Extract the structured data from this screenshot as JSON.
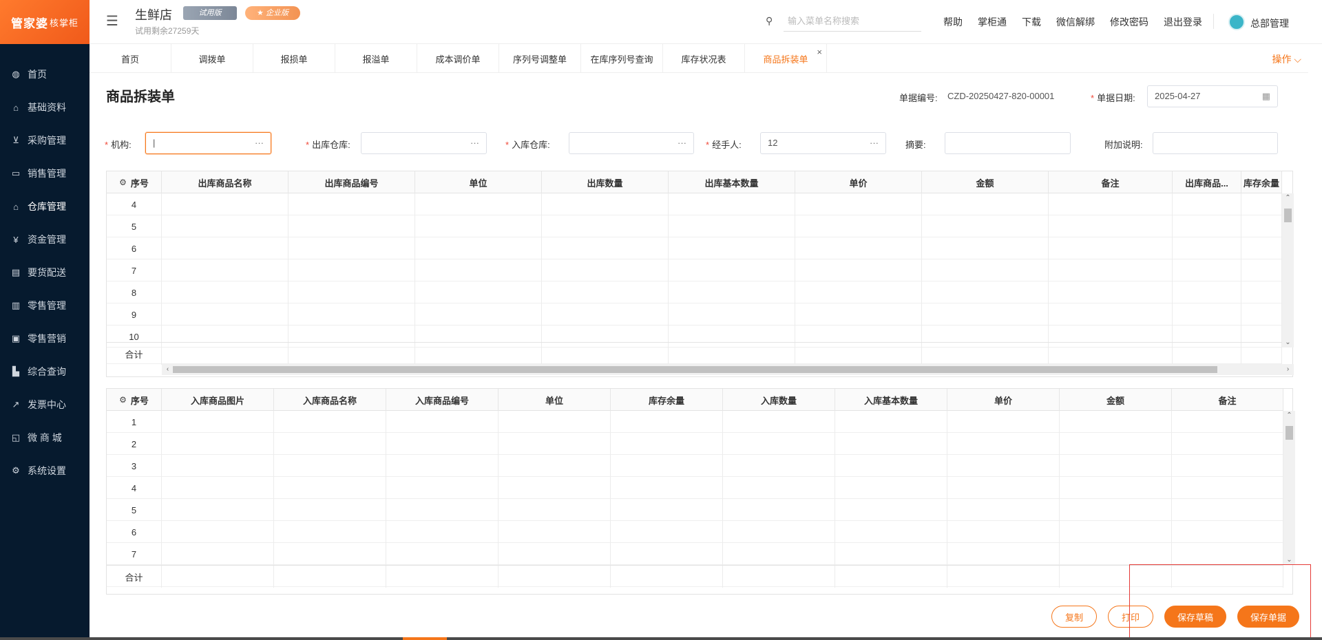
{
  "sidebar": {
    "logo": "管家婆",
    "logo_sub": "核掌柜",
    "items": [
      {
        "label": "首页",
        "icon": "globe-icon"
      },
      {
        "label": "基础资料",
        "icon": "home-icon"
      },
      {
        "label": "采购管理",
        "icon": "cart-icon"
      },
      {
        "label": "销售管理",
        "icon": "sales-icon"
      },
      {
        "label": "仓库管理",
        "icon": "warehouse-icon"
      },
      {
        "label": "资金管理",
        "icon": "fund-icon"
      },
      {
        "label": "要货配送",
        "icon": "delivery-icon"
      },
      {
        "label": "零售管理",
        "icon": "retail-icon"
      },
      {
        "label": "零售营销",
        "icon": "gift-icon"
      },
      {
        "label": "综合查询",
        "icon": "chart-icon"
      },
      {
        "label": "发票中心",
        "icon": "invoice-icon"
      },
      {
        "label": "微 商 城",
        "icon": "shop-icon"
      },
      {
        "label": "系统设置",
        "icon": "gear-icon"
      }
    ]
  },
  "header": {
    "store_name": "生鲜店",
    "badge_trial": "试用版",
    "badge_edition": "企业版",
    "trial_remaining": "试用剩余27259天",
    "search_placeholder": "输入菜单名称搜索",
    "links": [
      "帮助",
      "掌柜通",
      "下载",
      "微信解绑",
      "修改密码",
      "退出登录"
    ],
    "user": "总部管理"
  },
  "tabs": [
    {
      "label": "首页"
    },
    {
      "label": "调拨单"
    },
    {
      "label": "报损单"
    },
    {
      "label": "报溢单"
    },
    {
      "label": "成本调价单"
    },
    {
      "label": "序列号调整单"
    },
    {
      "label": "在库序列号查询"
    },
    {
      "label": "库存状况表"
    },
    {
      "label": "商品拆装单",
      "active": true
    }
  ],
  "ops_label": "操作 ⌵",
  "page": {
    "title": "商品拆装单",
    "doc_no_label": "单据编号:",
    "doc_no": "CZD-20250427-820-00001",
    "date_label": "单据日期:",
    "date": "2025-04-27"
  },
  "form": {
    "org_label": "机构:",
    "out_wh_label": "出库仓库:",
    "in_wh_label": "入库仓库:",
    "handler_label": "经手人:",
    "handler_value": "12",
    "summary_label": "摘要:",
    "note_label": "附加说明:"
  },
  "out_table": {
    "columns": [
      "序号",
      "出库商品名称",
      "出库商品编号",
      "单位",
      "出库数量",
      "出库基本数量",
      "单价",
      "金额",
      "备注",
      "出库商品...",
      "库存余量"
    ],
    "rows": [
      "4",
      "5",
      "6",
      "7",
      "8",
      "9",
      "10"
    ],
    "total_label": "合计"
  },
  "in_table": {
    "columns": [
      "序号",
      "入库商品图片",
      "入库商品名称",
      "入库商品编号",
      "单位",
      "库存余量",
      "入库数量",
      "入库基本数量",
      "单价",
      "金额",
      "备注"
    ],
    "rows": [
      "1",
      "2",
      "3",
      "4",
      "5",
      "6",
      "7"
    ],
    "total_label": "合计"
  },
  "buttons": {
    "copy": "复制",
    "print": "打印",
    "save_draft": "保存草稿",
    "save_doc": "保存单据"
  },
  "colors": {
    "accent": "#f5761a",
    "sidebar_bg": "#061a2e",
    "required": "#f04a3a"
  }
}
